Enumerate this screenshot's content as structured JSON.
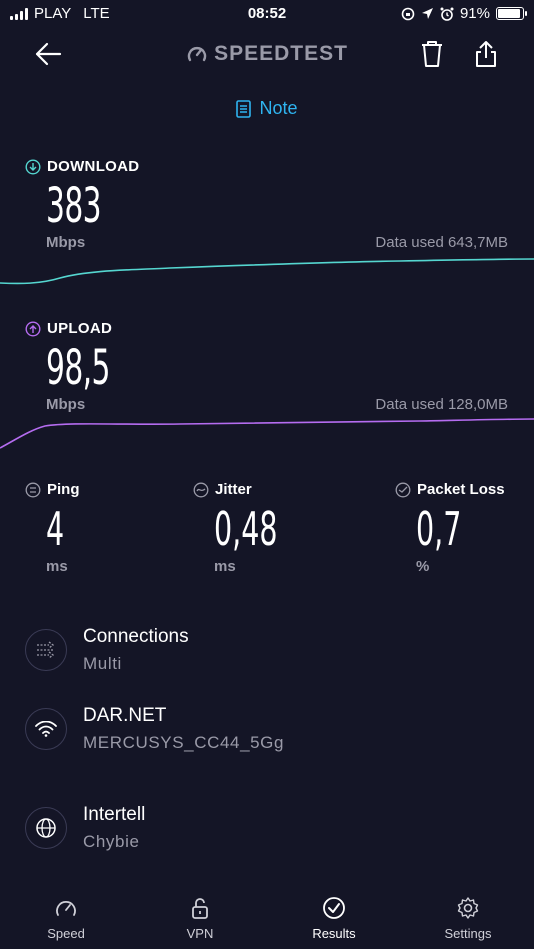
{
  "status_bar": {
    "carrier": "PLAY",
    "network": "LTE",
    "time": "08:52",
    "battery": "91%",
    "battery_level": 0.91
  },
  "header": {
    "brand": "SPEEDTEST",
    "note_label": "Note"
  },
  "download": {
    "label": "DOWNLOAD",
    "value": "383",
    "unit": "Mbps",
    "data_used": "Data used 643,7MB",
    "color": "#55d6d0"
  },
  "upload": {
    "label": "UPLOAD",
    "value": "98,5",
    "unit": "Mbps",
    "data_used": "Data used 128,0MB",
    "color": "#b56cf0"
  },
  "stats": {
    "ping": {
      "label": "Ping",
      "value": "4",
      "unit": "ms"
    },
    "jitter": {
      "label": "Jitter",
      "value": "0,48",
      "unit": "ms"
    },
    "packet_loss": {
      "label": "Packet Loss",
      "value": "0,7",
      "unit": "%"
    }
  },
  "info": {
    "connections": {
      "title": "Connections",
      "sub": "Multi"
    },
    "network": {
      "title": "DAR.NET",
      "sub": "MERCUSYS_CC44_5Gg"
    },
    "provider": {
      "title": "Intertell",
      "sub": "Chybie"
    }
  },
  "tabs": [
    {
      "label": "Speed",
      "icon": "speedometer-icon"
    },
    {
      "label": "VPN",
      "icon": "unlock-icon"
    },
    {
      "label": "Results",
      "icon": "check-circle-icon"
    },
    {
      "label": "Settings",
      "icon": "gear-icon"
    }
  ],
  "colors": {
    "background": "#141526",
    "accent_note": "#2fb4f0",
    "muted_text": "#9a9aa8"
  }
}
